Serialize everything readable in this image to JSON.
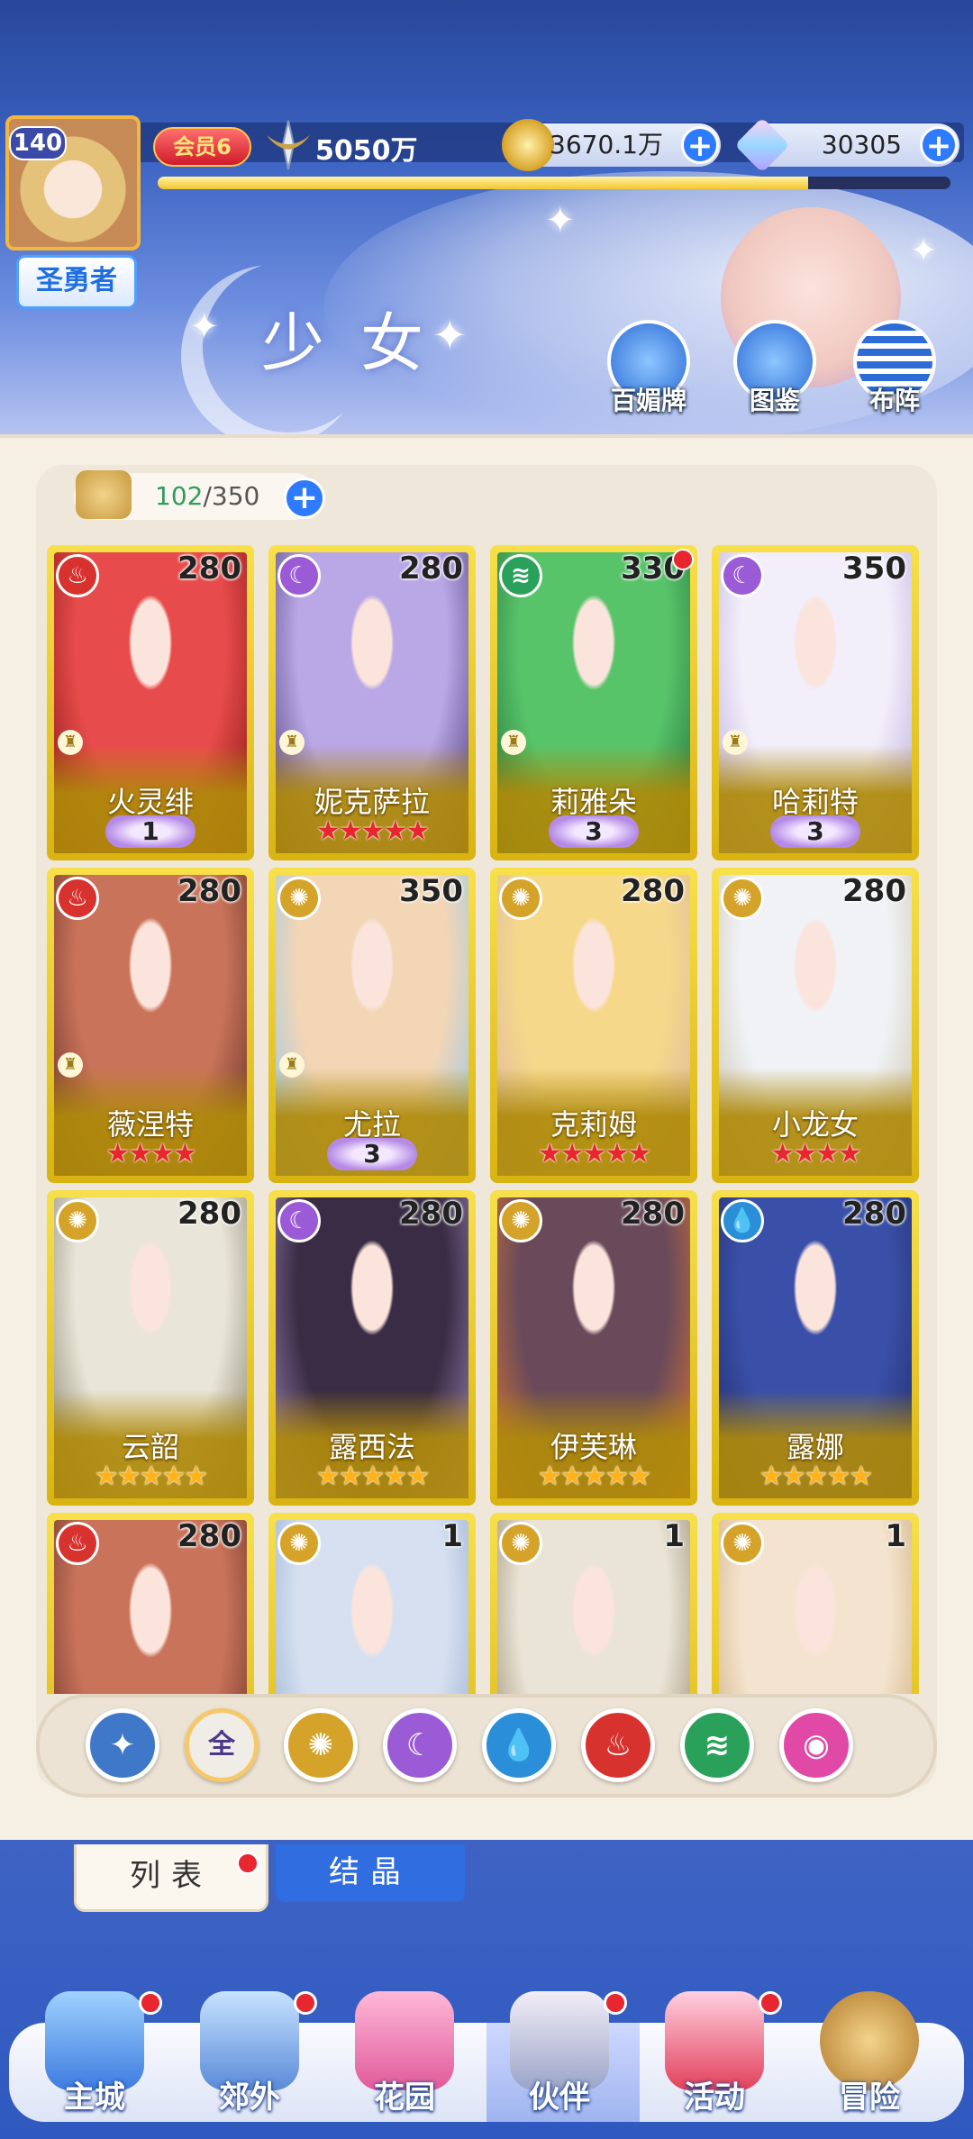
{
  "header": {
    "level": "140",
    "title_badge": "圣勇者",
    "vip": "会员6",
    "power": "5050万",
    "gold": "3670.1万",
    "gems": "30305",
    "xp_fraction": 0.82,
    "page_title": "少女",
    "buttons": [
      "百媚牌",
      "图鉴",
      "布阵"
    ]
  },
  "inventory": {
    "current": "102",
    "max": "/350"
  },
  "cards": [
    {
      "name": "火灵绯",
      "cost": "280",
      "element": "fire",
      "stars": 0,
      "wing": "1",
      "rank": true,
      "dot": false
    },
    {
      "name": "妮克萨拉",
      "cost": "280",
      "element": "moon",
      "stars": 5,
      "wing": "",
      "rank": true,
      "dot": false
    },
    {
      "name": "莉雅朵",
      "cost": "330",
      "element": "wind",
      "stars": 0,
      "wing": "3",
      "rank": true,
      "dot": true
    },
    {
      "name": "哈莉特",
      "cost": "350",
      "element": "moon",
      "stars": 0,
      "wing": "3",
      "rank": true,
      "dot": false
    },
    {
      "name": "薇涅特",
      "cost": "280",
      "element": "fire",
      "stars": 4,
      "wing": "",
      "rank": true,
      "dot": false
    },
    {
      "name": "尤拉",
      "cost": "350",
      "element": "sun",
      "stars": 0,
      "wing": "3",
      "rank": true,
      "dot": false
    },
    {
      "name": "克莉姆",
      "cost": "280",
      "element": "sun",
      "stars": 5,
      "wing": "",
      "rank": false,
      "dot": false
    },
    {
      "name": "小龙女",
      "cost": "280",
      "element": "sun",
      "stars": 4,
      "wing": "",
      "rank": false,
      "dot": false
    },
    {
      "name": "云韶",
      "cost": "280",
      "element": "sun",
      "stars": 5,
      "wing": "",
      "rank": false,
      "dot": false,
      "gold_stars": true
    },
    {
      "name": "露西法",
      "cost": "280",
      "element": "moon",
      "stars": 5,
      "wing": "",
      "rank": false,
      "dot": false,
      "gold_stars": true
    },
    {
      "name": "伊芙琳",
      "cost": "280",
      "element": "sun",
      "stars": 5,
      "wing": "",
      "rank": false,
      "dot": false,
      "gold_stars": true
    },
    {
      "name": "露娜",
      "cost": "280",
      "element": "water",
      "stars": 5,
      "wing": "",
      "rank": false,
      "dot": false,
      "gold_stars": true
    },
    {
      "name": "",
      "cost": "280",
      "element": "fire",
      "stars": 0,
      "wing": "",
      "rank": false,
      "dot": false
    },
    {
      "name": "",
      "cost": "1",
      "element": "sun",
      "stars": 0,
      "wing": "",
      "rank": false,
      "dot": false
    },
    {
      "name": "",
      "cost": "1",
      "element": "sun",
      "stars": 0,
      "wing": "",
      "rank": false,
      "dot": false
    },
    {
      "name": "",
      "cost": "1",
      "element": "sun",
      "stars": 0,
      "wing": "",
      "rank": false,
      "dot": false
    }
  ],
  "filters": [
    {
      "id": "all-elements",
      "label": "",
      "color": "#3f78c8"
    },
    {
      "id": "all",
      "label": "全",
      "color": "#f0ece6"
    },
    {
      "id": "sun",
      "label": "",
      "color": "#d5a32a"
    },
    {
      "id": "moon",
      "label": "",
      "color": "#9b5ad6"
    },
    {
      "id": "water",
      "label": "",
      "color": "#2a8fd8"
    },
    {
      "id": "fire",
      "label": "",
      "color": "#d8322e"
    },
    {
      "id": "wind",
      "label": "",
      "color": "#2aa15a"
    },
    {
      "id": "planet",
      "label": "",
      "color": "#e04aa6"
    }
  ],
  "tabs": {
    "list": "列表",
    "crystal": "结晶"
  },
  "nav": [
    "主城",
    "郊外",
    "花园",
    "伙伴",
    "活动",
    "冒险"
  ],
  "colors": {
    "fire": "#d8322e",
    "moon": "#9b5ad6",
    "wind": "#2aa15a",
    "sun": "#d5a32a",
    "water": "#2a8fd8"
  }
}
